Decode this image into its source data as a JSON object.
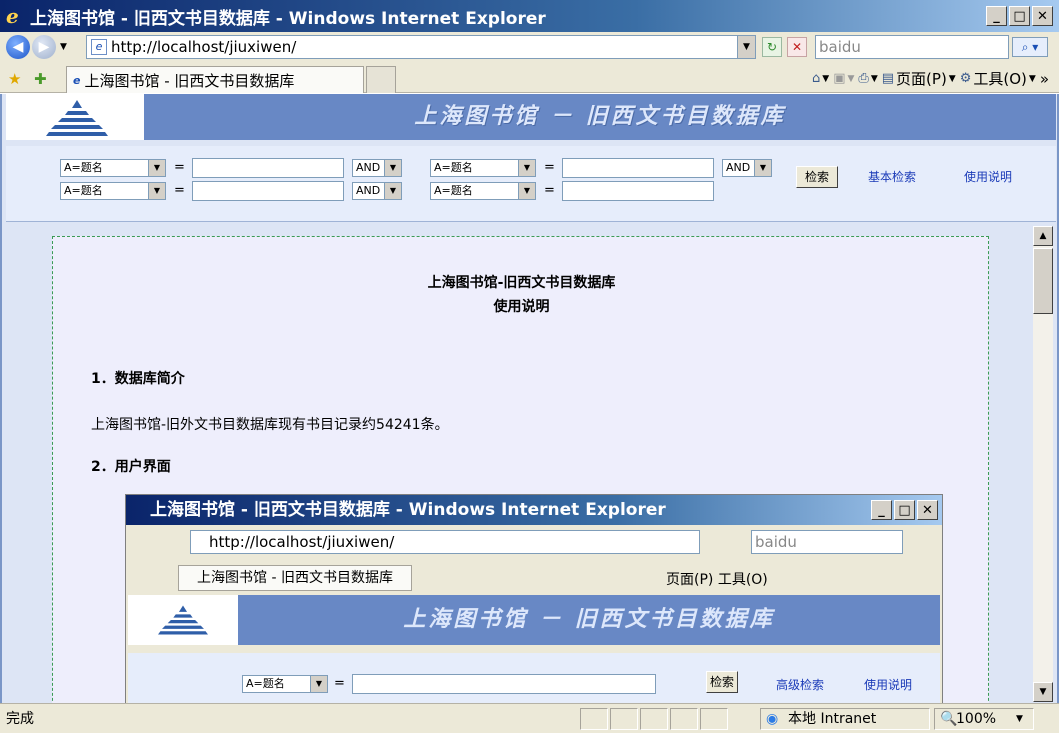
{
  "window": {
    "title": "上海图书馆 - 旧西文书目数据库 - Windows Internet Explorer",
    "minimize": "_",
    "maximize": "□",
    "close": "✕"
  },
  "toolbar": {
    "address": "http://localhost/jiuxiwen/",
    "search_placeholder": "baidu",
    "search_icon": "search-icon"
  },
  "tabs": {
    "active_label": "上海图书馆 - 旧西文书目数据库"
  },
  "command_bar": {
    "page_label": "页面(P)",
    "tools_label": "工具(O)",
    "more": "»"
  },
  "banner": {
    "title": "上海图书馆 － 旧西文书目数据库"
  },
  "search_form": {
    "rows": [
      {
        "field1": "A=题名",
        "op1": "AND",
        "field2": "A=题名",
        "op2": "AND"
      },
      {
        "field1": "A=题名",
        "op1": "AND",
        "field2": "A=题名"
      }
    ],
    "equals": "=",
    "search_button": "检索",
    "basic_search_link": "基本检索",
    "help_link": "使用说明"
  },
  "doc": {
    "title": "上海图书馆-旧西文书目数据库",
    "subtitle": "使用说明",
    "section1_heading": "1．数据库简介",
    "section1_text": "上海图书馆-旧外文书目数据库现有书目记录约54241条。",
    "section2_heading": "2．用户界面"
  },
  "inner_screenshot": {
    "title": "上海图书馆 - 旧西文书目数据库 - Windows Internet Explorer",
    "address": "http://localhost/jiuxiwen/",
    "search": "baidu",
    "tab": "上海图书馆 - 旧西文书目数据库",
    "page_label": "页面(P)",
    "tools_label": "工具(O)",
    "banner_title": "上海图书馆 － 旧西文书目数据库",
    "field": "A=题名",
    "search_button": "检索",
    "advanced_link": "高级检索",
    "help_link": "使用说明"
  },
  "statusbar": {
    "status": "完成",
    "zone": "本地 Intranet",
    "zoom": "100%"
  },
  "colors": {
    "banner_blue": "#6888c5",
    "link_blue": "#1b3bb8",
    "doc_border": "#3b9b55"
  }
}
